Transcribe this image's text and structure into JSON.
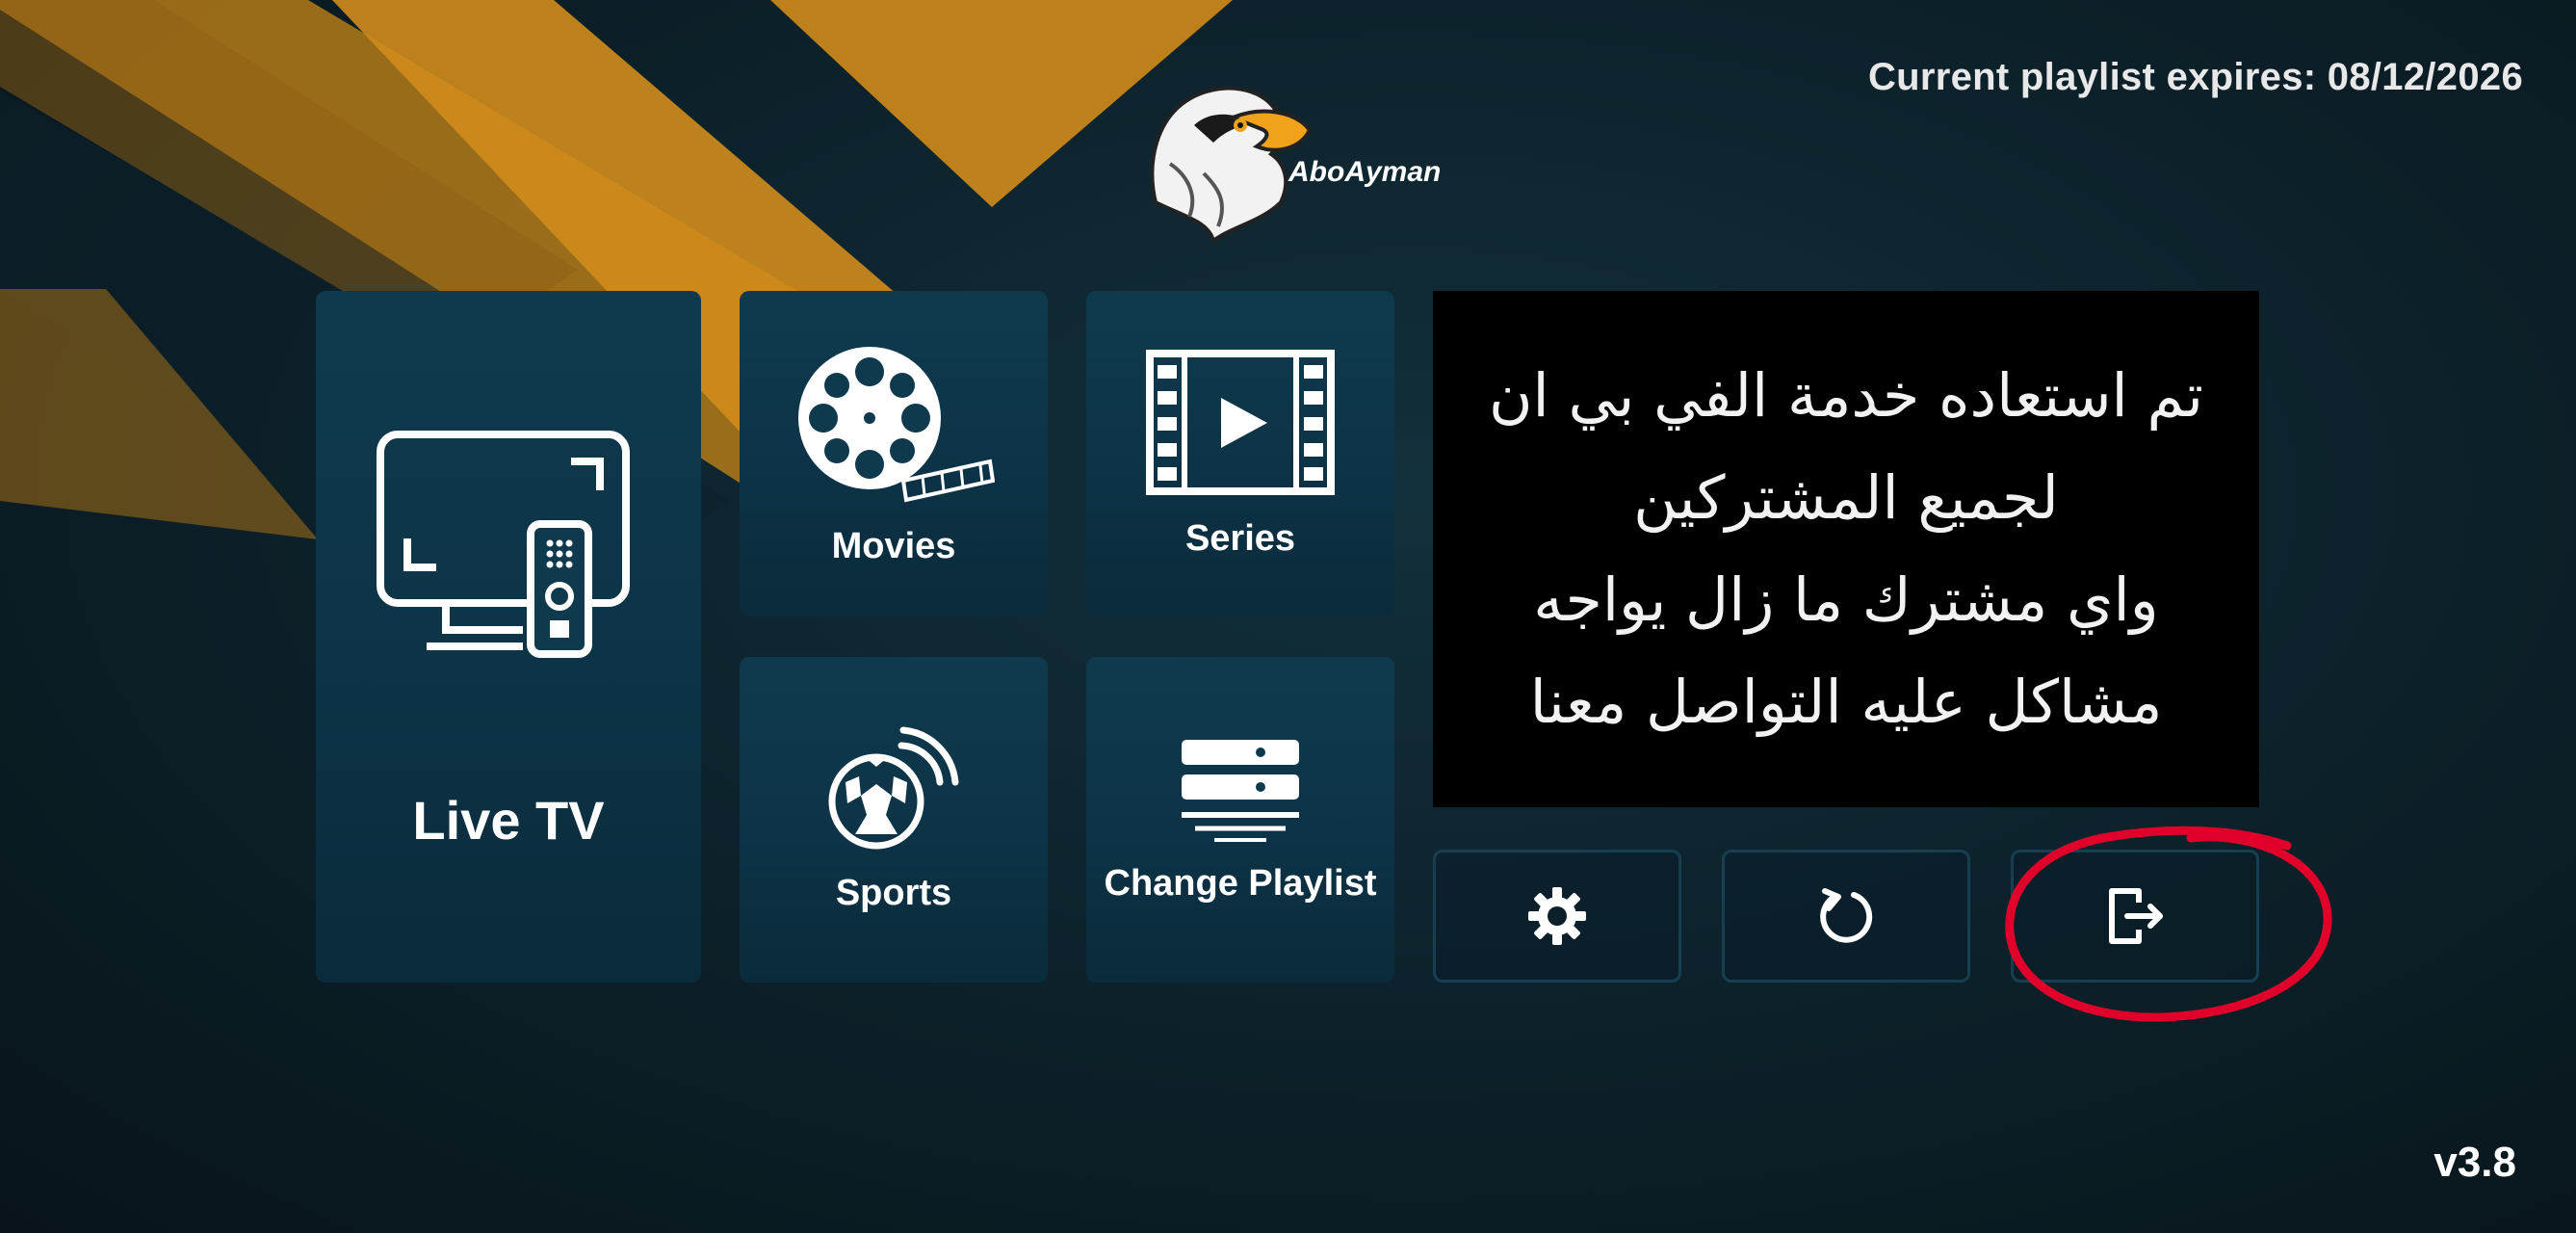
{
  "header": {
    "expiry_text": "Current playlist expires: 08/12/2026",
    "logo_text": "AboAyman"
  },
  "tiles": {
    "live_tv": "Live TV",
    "movies": "Movies",
    "series": "Series",
    "sports": "Sports",
    "change_playlist": "Change Playlist"
  },
  "message": {
    "lines": [
      "تم استعاده خدمة الفي بي ان",
      "لجميع المشتركين",
      "واي مشترك ما زال يواجه",
      "مشاكل عليه التواصل معنا"
    ]
  },
  "actions": {
    "settings_icon": "gear-icon",
    "refresh_icon": "refresh-icon",
    "logout_icon": "logout-icon"
  },
  "footer": {
    "version": "v3.8"
  },
  "colors": {
    "stripe": "#c8861a",
    "tile": "#0f3a4e",
    "annotation": "#e0002a"
  }
}
